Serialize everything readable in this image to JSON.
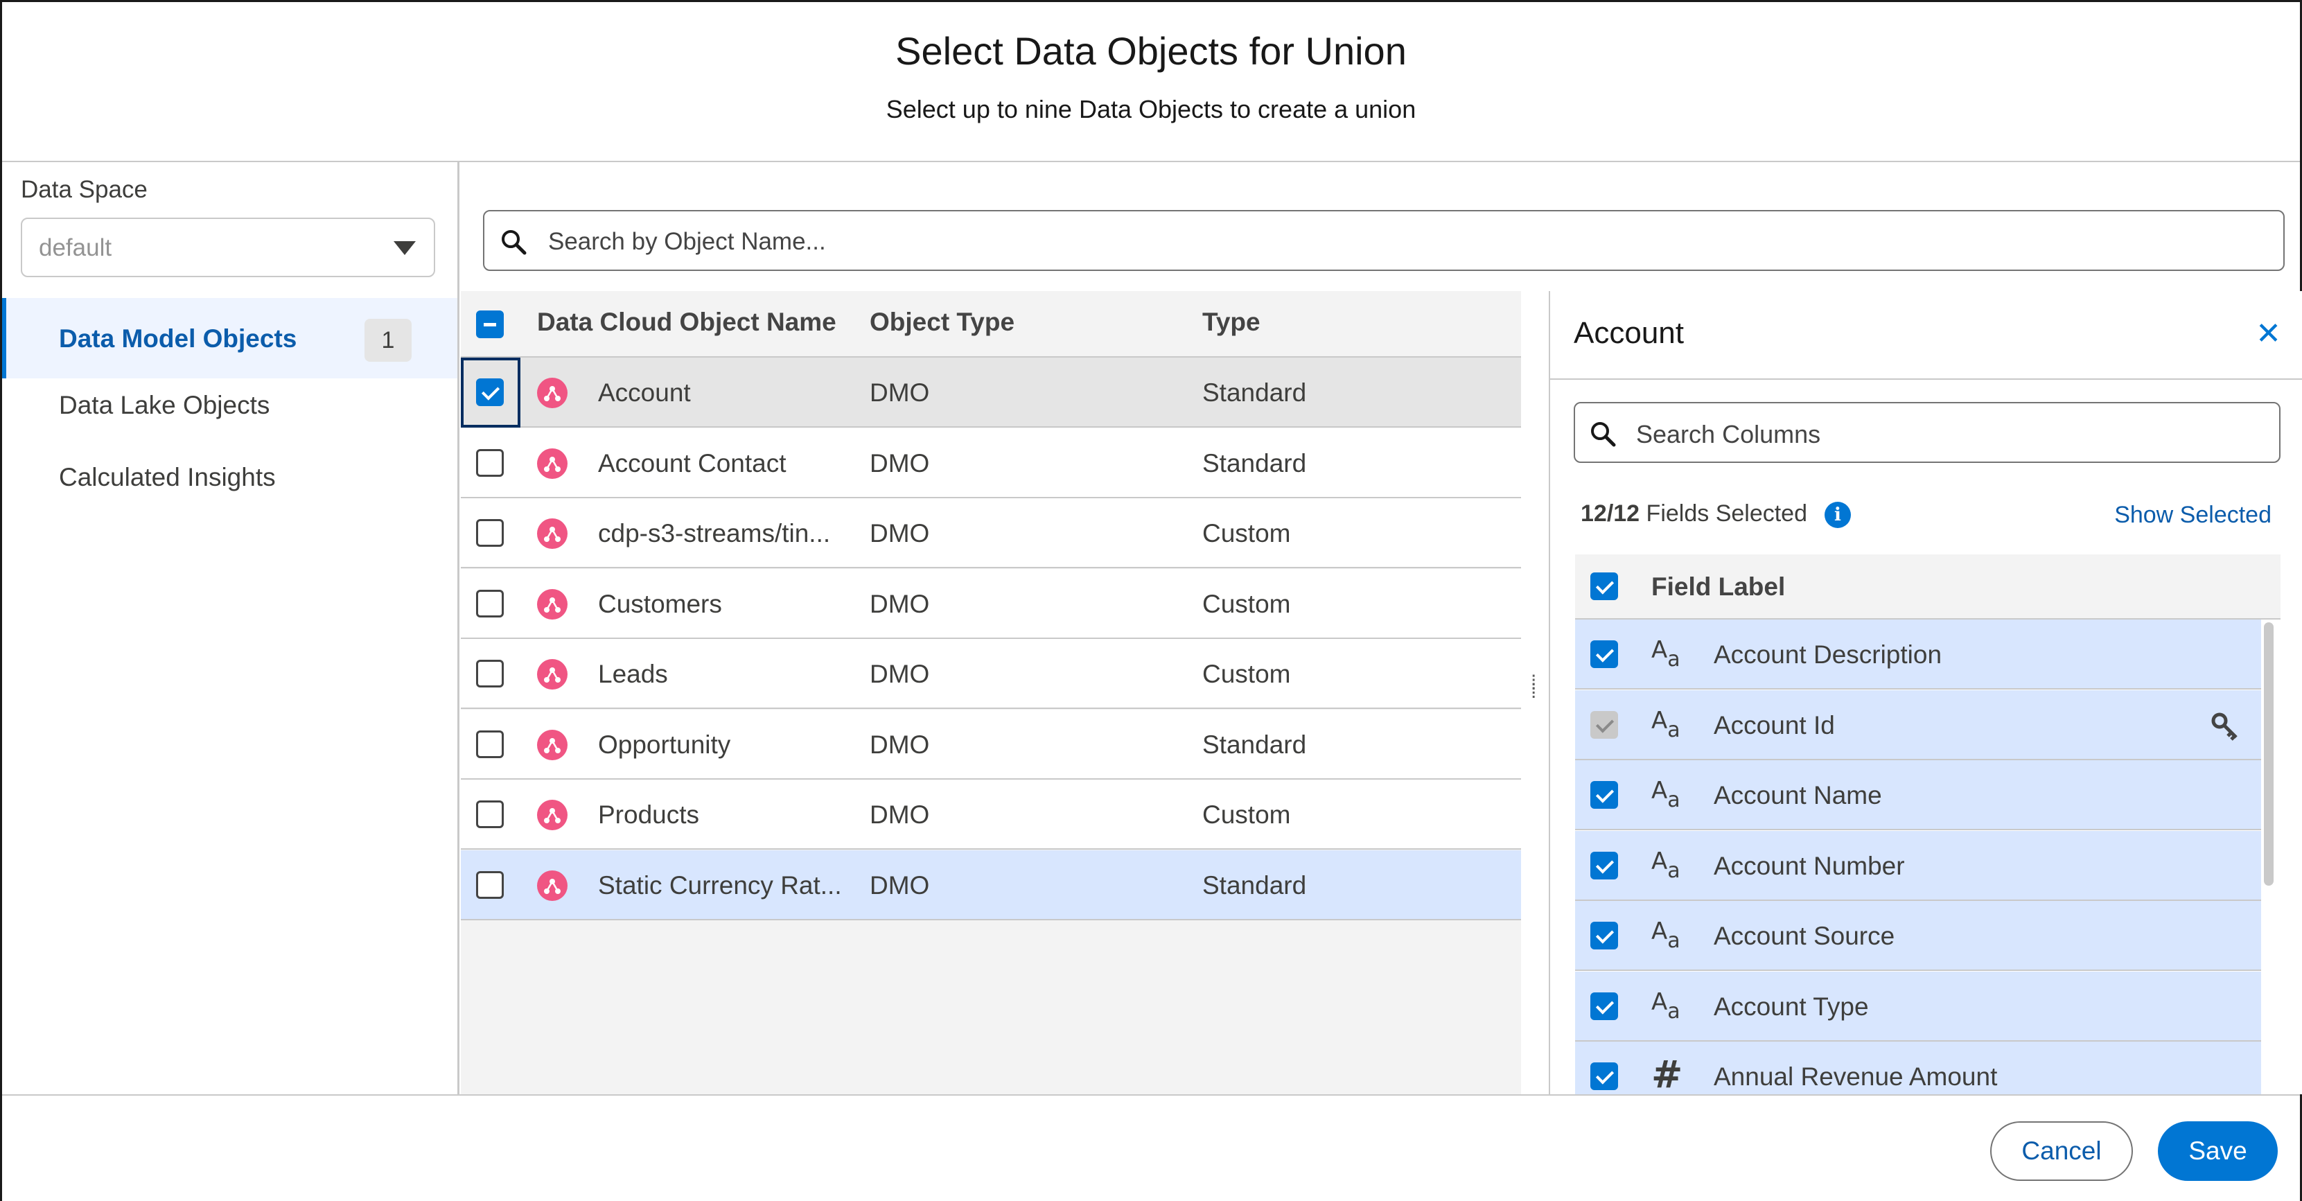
{
  "header": {
    "title": "Select Data Objects for Union",
    "subtitle": "Select up to nine Data Objects to create a union"
  },
  "sidebar": {
    "data_space_label": "Data Space",
    "data_space_value": "default",
    "items": [
      {
        "label": "Data Model Objects",
        "count": "1",
        "active": true
      },
      {
        "label": "Data Lake Objects"
      },
      {
        "label": "Calculated Insights"
      }
    ]
  },
  "search": {
    "placeholder": "Search by Object Name..."
  },
  "table": {
    "columns": [
      "Data Cloud Object Name",
      "Object Type",
      "Type"
    ],
    "rows": [
      {
        "name": "Account",
        "object_type": "DMO",
        "type": "Standard",
        "checked": true
      },
      {
        "name": "Account Contact",
        "object_type": "DMO",
        "type": "Standard",
        "checked": false
      },
      {
        "name": "cdp-s3-streams/tin...",
        "object_type": "DMO",
        "type": "Custom",
        "checked": false
      },
      {
        "name": "Customers",
        "object_type": "DMO",
        "type": "Custom",
        "checked": false
      },
      {
        "name": "Leads",
        "object_type": "DMO",
        "type": "Custom",
        "checked": false
      },
      {
        "name": "Opportunity",
        "object_type": "DMO",
        "type": "Standard",
        "checked": false
      },
      {
        "name": "Products",
        "object_type": "DMO",
        "type": "Custom",
        "checked": false
      },
      {
        "name": "Static Currency Rat...",
        "object_type": "DMO",
        "type": "Standard",
        "checked": false
      }
    ]
  },
  "panel": {
    "title": "Account",
    "search_placeholder": "Search Columns",
    "fields_selected_count": "12/12",
    "fields_selected_text": "Fields Selected",
    "show_selected": "Show Selected",
    "field_label_header": "Field Label",
    "fields": [
      {
        "label": "Account Description",
        "type_icon": "text-type-icon",
        "checked": true
      },
      {
        "label": "Account Id",
        "type_icon": "text-type-icon",
        "checked": true,
        "disabled": true,
        "key": true
      },
      {
        "label": "Account Name",
        "type_icon": "text-type-icon",
        "checked": true
      },
      {
        "label": "Account Number",
        "type_icon": "text-type-icon",
        "checked": true
      },
      {
        "label": "Account Source",
        "type_icon": "text-type-icon",
        "checked": true
      },
      {
        "label": "Account Type",
        "type_icon": "text-type-icon",
        "checked": true
      },
      {
        "label": "Annual Revenue Amount",
        "type_icon": "number-type-icon",
        "checked": true
      }
    ]
  },
  "footer": {
    "cancel": "Cancel",
    "save": "Save"
  },
  "colors": {
    "brand": "#0176d3",
    "object_icon": "#f05583",
    "selected_row": "#d8e6fe"
  }
}
